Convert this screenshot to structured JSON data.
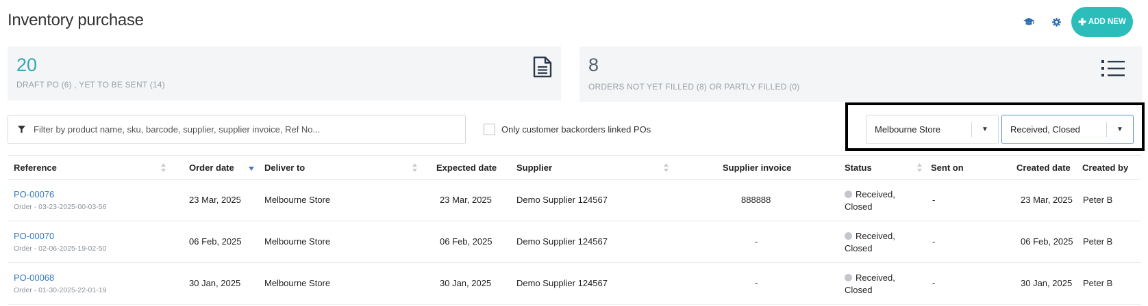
{
  "header": {
    "title": "Inventory purchase",
    "add_new_label": "ADD NEW",
    "add_new_icon": "plus-icon",
    "help_icon": "graduation-cap-icon",
    "settings_icon": "gear-icon"
  },
  "cards": [
    {
      "value": "20",
      "label": "DRAFT PO (6) , YET TO BE SENT (14)",
      "icon": "document-icon",
      "accent": "#33a7b2"
    },
    {
      "value": "8",
      "label": "ORDERS NOT YET FILLED (8) OR PARTLY FILLED (0)",
      "icon": "list-icon",
      "accent": "#555e6b"
    }
  ],
  "filter": {
    "placeholder": "Filter by product name, sku, barcode, supplier, supplier invoice, Ref No...",
    "value": "",
    "backorders_label": "Only customer backorders linked POs",
    "backorders_checked": false,
    "store_select": "Melbourne Store",
    "status_select": "Received, Closed"
  },
  "table": {
    "columns": [
      "Reference",
      "Order date",
      "Deliver to",
      "Expected date",
      "Supplier",
      "Supplier invoice",
      "Status",
      "Sent on",
      "Created date",
      "Created by"
    ],
    "rows": [
      {
        "reference": "PO-00076",
        "sub": "Order - 03-23-2025-00-03-56",
        "order_date": "23 Mar, 2025",
        "deliver_to": "Melbourne Store",
        "expected_date": "23 Mar, 2025",
        "supplier": "Demo Supplier 124567",
        "invoice": "888888",
        "status_line1": "Received,",
        "status_line2": "Closed",
        "sent_on": "-",
        "created_date": "23 Mar, 2025",
        "created_by": "Peter B"
      },
      {
        "reference": "PO-00070",
        "sub": "Order - 02-06-2025-19-02-50",
        "order_date": "06 Feb, 2025",
        "deliver_to": "Melbourne Store",
        "expected_date": "06 Feb, 2025",
        "supplier": "Demo Supplier 124567",
        "invoice": "-",
        "status_line1": "Received,",
        "status_line2": "Closed",
        "sent_on": "-",
        "created_date": "06 Feb, 2025",
        "created_by": "Peter B"
      },
      {
        "reference": "PO-00068",
        "sub": "Order - 01-30-2025-22-01-19",
        "order_date": "30 Jan, 2025",
        "deliver_to": "Melbourne Store",
        "expected_date": "30 Jan, 2025",
        "supplier": "Demo Supplier 124567",
        "invoice": "-",
        "status_line1": "Received,",
        "status_line2": "Closed",
        "sent_on": "-",
        "created_date": "30 Jan, 2025",
        "created_by": "Peter B"
      }
    ]
  },
  "colors": {
    "brand": "#2bbdba",
    "link": "#3178c6",
    "card_bg": "#f3f5f7",
    "status_dot": "#c3c7cc"
  }
}
